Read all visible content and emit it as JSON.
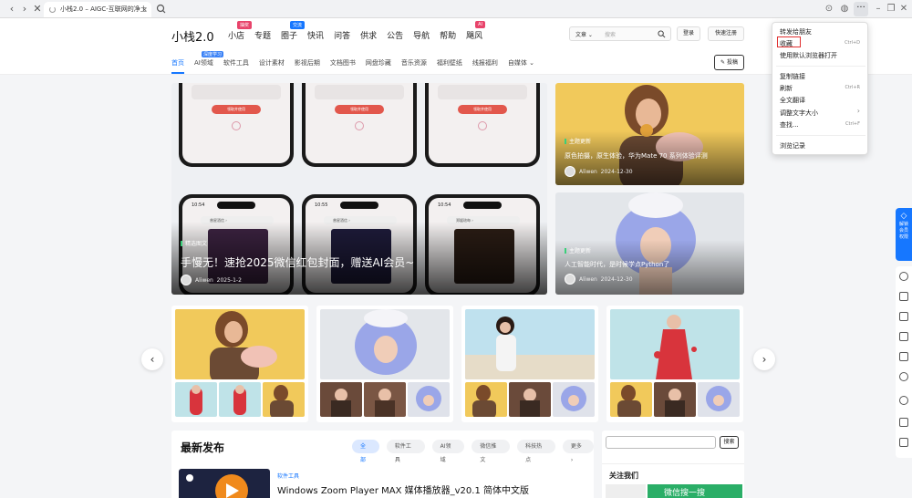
{
  "browser": {
    "tab_title": "小栈2.0 – AIGC-互联网的净土",
    "tab_close": "×"
  },
  "site": {
    "logo": "小栈2.0",
    "nav": [
      {
        "label": "小店",
        "badge": "抽奖",
        "badge_color": "#e8446b"
      },
      {
        "label": "专题",
        "badge": "",
        "badge_color": ""
      },
      {
        "label": "圈子",
        "badge": "交流",
        "badge_color": "#1677ff"
      },
      {
        "label": "快讯",
        "badge": "",
        "badge_color": ""
      },
      {
        "label": "问答",
        "badge": "",
        "badge_color": ""
      },
      {
        "label": "供求",
        "badge": "",
        "badge_color": ""
      },
      {
        "label": "公告",
        "badge": "",
        "badge_color": ""
      },
      {
        "label": "导航",
        "badge": "",
        "badge_color": ""
      },
      {
        "label": "帮助",
        "badge": "",
        "badge_color": ""
      },
      {
        "label": "飓风",
        "badge": "AI",
        "badge_color": "#e8446b"
      }
    ],
    "search_category": "文章 ⌄",
    "search_placeholder": "搜索",
    "login": "登录",
    "register": "快速注册",
    "subnav": [
      {
        "label": "首页",
        "badge": ""
      },
      {
        "label": "AI领域",
        "badge": "深度学习"
      },
      {
        "label": "软件工具",
        "badge": ""
      },
      {
        "label": "设计素材",
        "badge": ""
      },
      {
        "label": "影视后期",
        "badge": ""
      },
      {
        "label": "文档图书",
        "badge": ""
      },
      {
        "label": "网盘珍藏",
        "badge": ""
      },
      {
        "label": "音乐资源",
        "badge": ""
      },
      {
        "label": "福利壁纸",
        "badge": ""
      },
      {
        "label": "线报福利",
        "badge": ""
      },
      {
        "label": "自媒体 ⌄",
        "badge": ""
      }
    ],
    "post_button": "✎ 投稿"
  },
  "hero": {
    "main": {
      "category": "精选图文",
      "title": "手慢无！速抢2025微信红包封面，赠送AI会员~",
      "author": "Aliwen",
      "date": "2025-1-2"
    },
    "cards": [
      {
        "category": "主题更新",
        "title": "原色拍摄，原生体验，华为Mate 70 系列体验评测",
        "author": "Aliwen",
        "date": "2024-12-30"
      },
      {
        "category": "主题更新",
        "title": "人工智能时代，是时候学点Python了",
        "author": "Aliwen",
        "date": "2024-12-30"
      }
    ],
    "phone_labels": [
      "领取并使用",
      "领取并使用",
      "领取并使用"
    ],
    "phone_times": [
      "10:54",
      "10:55",
      "10:54"
    ],
    "phone_pills": [
      "普星酒信 ›",
      "普星酒信 ›",
      "郑媛瑄每 ›"
    ]
  },
  "carousel": {
    "prev": "‹",
    "next": "›"
  },
  "latest": {
    "heading": "最新发布",
    "tabs": [
      "全部",
      "软件工具",
      "AI领域",
      "微信推文",
      "科技热点",
      "更多 ›"
    ],
    "post_category": "软件工具",
    "post_title": "Windows Zoom Player MAX 媒体播放器_v20.1 简体中文版"
  },
  "sidebar": {
    "search_button": "搜索",
    "follow_title": "关注我们",
    "wechat_label": "微信搜一搜"
  },
  "floatbar": {
    "top_label_1": "解锁",
    "top_label_2": "会员",
    "top_label_3": "权限"
  },
  "context_menu": {
    "items": [
      {
        "label": "转发给朋友",
        "shortcut": ""
      },
      {
        "label": "收藏",
        "shortcut": "Ctrl+D"
      },
      {
        "label": "使用默认浏览器打开",
        "shortcut": ""
      },
      {
        "label": "复制链接",
        "shortcut": ""
      },
      {
        "label": "刷新",
        "shortcut": "Ctrl+R"
      },
      {
        "label": "全文翻译",
        "shortcut": ""
      },
      {
        "label": "调整文字大小",
        "shortcut": "›"
      },
      {
        "label": "查找...",
        "shortcut": "Ctrl+F"
      },
      {
        "label": "浏览记录",
        "shortcut": ""
      }
    ]
  },
  "colors": {
    "accent": "#1677ff",
    "highlight_box": "#e03030",
    "wechat_green": "#2aae67"
  }
}
